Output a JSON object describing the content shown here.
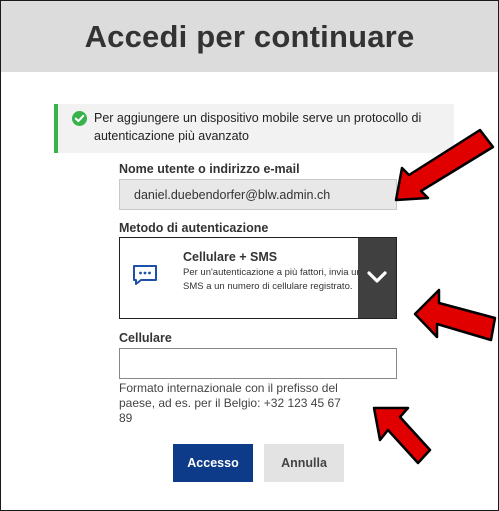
{
  "header": {
    "title": "Accedi per continuare"
  },
  "notice": {
    "text": "Per aggiungere un dispositivo mobile serve un protocollo di autenticazione più avanzato",
    "icon": "check-circle-icon",
    "accent": "#38b349"
  },
  "username": {
    "label": "Nome utente o indirizzo e-mail",
    "value": "daniel.duebendorfer@blw.admin.ch"
  },
  "auth_method": {
    "label": "Metodo di autenticazione",
    "selected_title": "Cellulare + SMS",
    "selected_description": "Per un'autenticazione a più fattori, invia un SMS a un numero di cellulare registrato.",
    "icon": "sms-message-icon"
  },
  "phone": {
    "label": "Cellulare",
    "value": "",
    "hint": "Formato internazionale con il prefisso del paese, ad es. per il Belgio: +32 123 45 67 89"
  },
  "buttons": {
    "submit": "Accesso",
    "cancel": "Annulla"
  },
  "colors": {
    "primary": "#0e3a8a",
    "annotation_arrow": "#e00000"
  }
}
